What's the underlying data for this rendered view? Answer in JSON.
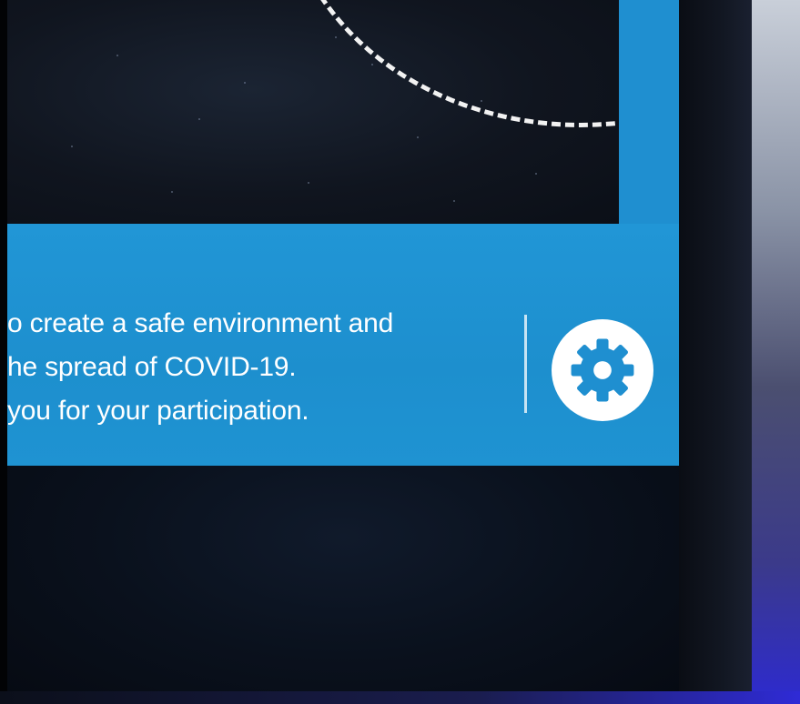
{
  "kiosk": {
    "message_lines": [
      "o create a safe environment and",
      "he spread of COVID-19.",
      "you for your participation."
    ],
    "settings_icon": "gear-icon",
    "colors": {
      "message_bar": "#1f8fd0",
      "camera_view": "#10151f",
      "text": "#ffffff",
      "settings_button": "#ffffff",
      "gear": "#1f8fd0"
    }
  }
}
